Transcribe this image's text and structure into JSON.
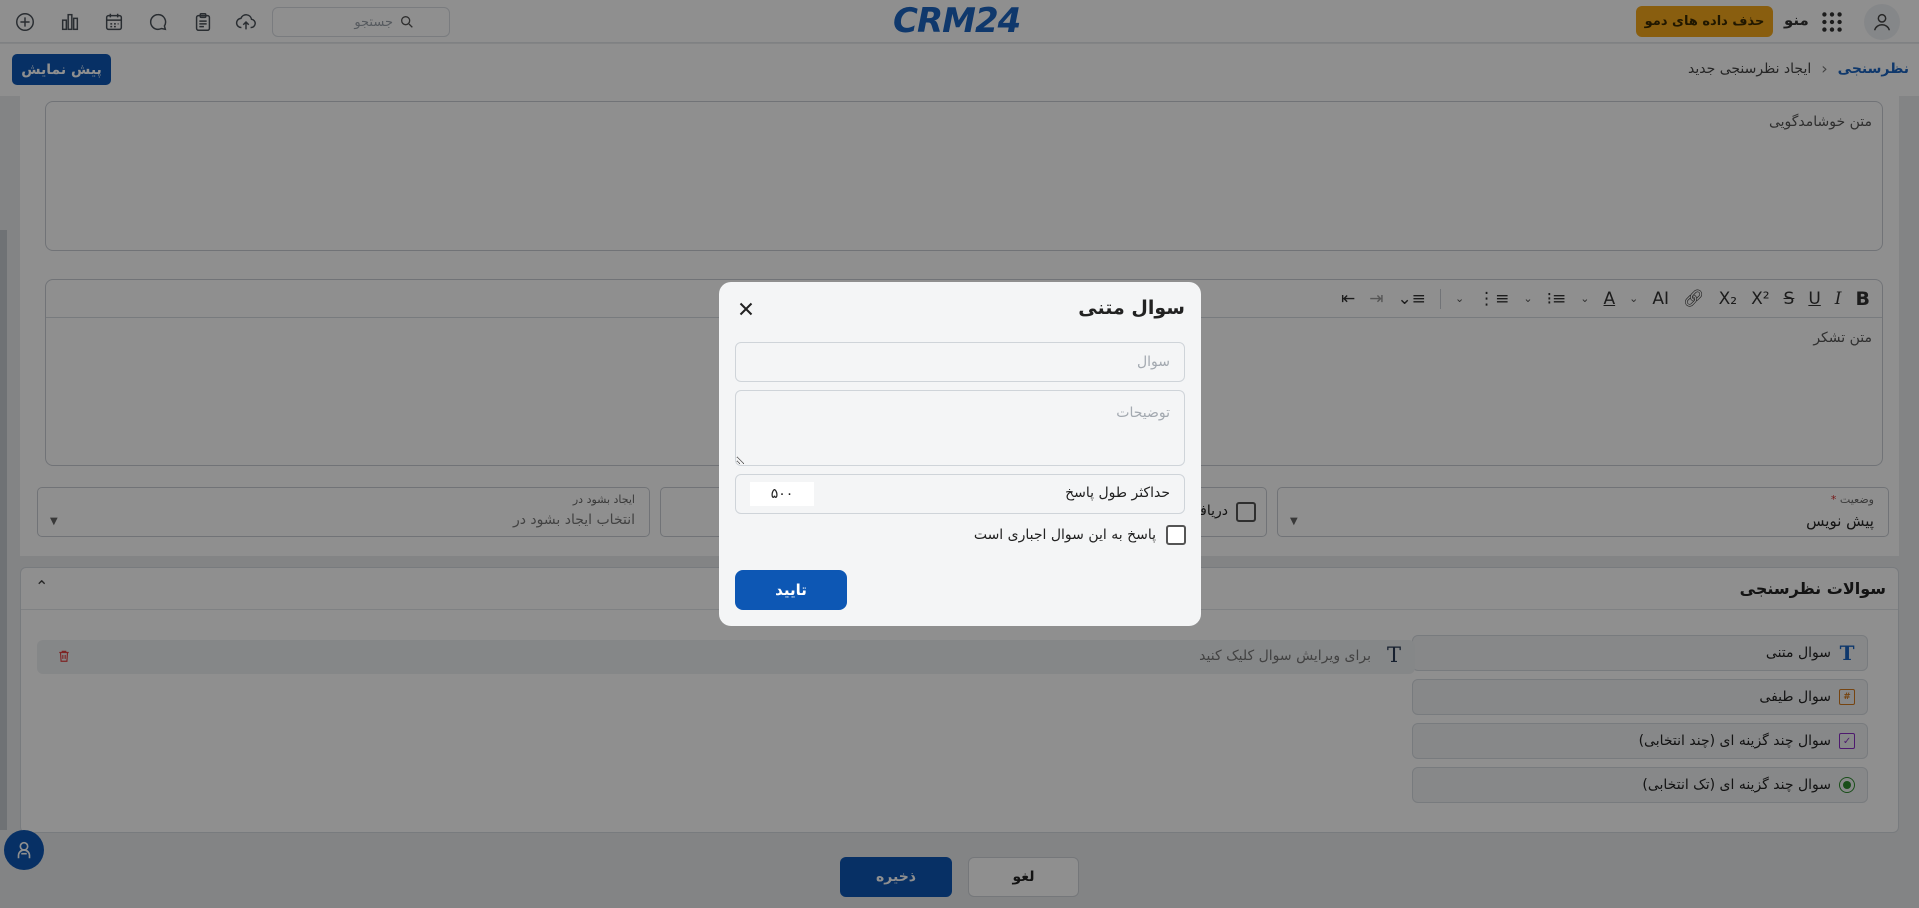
{
  "topbar": {
    "search_placeholder": "جستجو",
    "logo_text": "CRM24",
    "delete_demo_label": "حذف داده های دمو",
    "menu_label": "منو",
    "icons": [
      "add-icon",
      "chart-icon",
      "calendar-icon",
      "chat-icon",
      "clipboard-icon",
      "cloud-upload-icon"
    ]
  },
  "subheader": {
    "preview_label": "پیش نمایش",
    "breadcrumb": [
      "نظرسنجی",
      "ایجاد نظرسنجی جدید"
    ]
  },
  "form": {
    "welcome_text_label": "متن خوشامدگویی",
    "thanks_text_label": "متن تشکر",
    "status": {
      "label": "وضعیت",
      "required_mark": "*",
      "value": "پیش نویس"
    },
    "receive_label": "دریافت",
    "create_in": {
      "label": "ایجاد بشود در",
      "value": "انتخاب ایجاد بشود در"
    }
  },
  "toolbar_labels": {
    "bold": "B",
    "italic": "I",
    "underline": "U",
    "strike": "S",
    "superscript": "X²",
    "subscript": "X₂",
    "ai": "AI",
    "font_color": "A"
  },
  "questions_section": {
    "title": "سوالات نظرسنجی",
    "types": [
      {
        "label": "سوال متنی",
        "icon": "text-type-icon"
      },
      {
        "label": "سوال طیفی",
        "icon": "range-type-icon"
      },
      {
        "label": "سوال چند گزینه ای (چند انتخابی)",
        "icon": "multi-choice-icon"
      },
      {
        "label": "سوال چند گزینه ای (تک انتخابی)",
        "icon": "single-choice-icon"
      }
    ],
    "item_placeholder": "برای ویرایش سوال کلیک کنید"
  },
  "footer": {
    "save_label": "ذخیره",
    "cancel_label": "لغو"
  },
  "modal": {
    "title": "سوال متنی",
    "question_placeholder": "سوال",
    "description_placeholder": "توضیحات",
    "max_length_label": "حداکثر طول پاسخ",
    "max_length_value": "۵۰۰",
    "required_label": "پاسخ به این سوال اجباری است",
    "required_checked": false,
    "confirm_label": "تایید"
  },
  "colors": {
    "primary": "#0d57b4",
    "demo_button": "#f5a81c",
    "logo": "#1b64c0"
  }
}
